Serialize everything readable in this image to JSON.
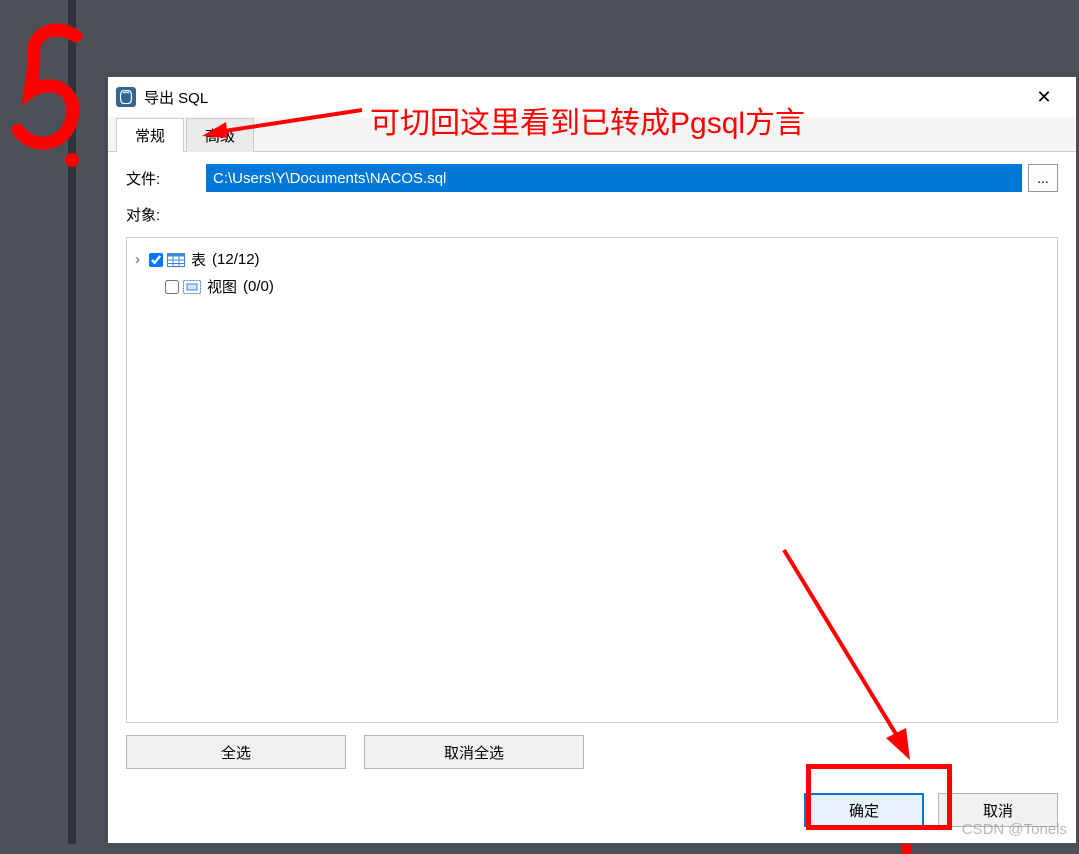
{
  "annotation": {
    "step_number": "5.",
    "note": "可切回这里看到已转成Pgsql方言"
  },
  "dialog": {
    "title": "导出 SQL",
    "app_icon_label": "pg"
  },
  "tabs": {
    "general": "常规",
    "advanced": "高级"
  },
  "form": {
    "file_label": "文件:",
    "file_path": "C:\\Users\\Y\\Documents\\NACOS.sql",
    "browse_label": "...",
    "objects_label": "对象:"
  },
  "tree": {
    "tables": {
      "label": "表",
      "count": "(12/12)",
      "checked": true
    },
    "views": {
      "label": "视图",
      "count": "(0/0)",
      "checked": false
    }
  },
  "buttons": {
    "select_all": "全选",
    "deselect_all": "取消全选",
    "ok": "确定",
    "cancel": "取消"
  },
  "watermark": "CSDN @Tonels",
  "icons": {
    "close": "✕",
    "expander": "›"
  }
}
